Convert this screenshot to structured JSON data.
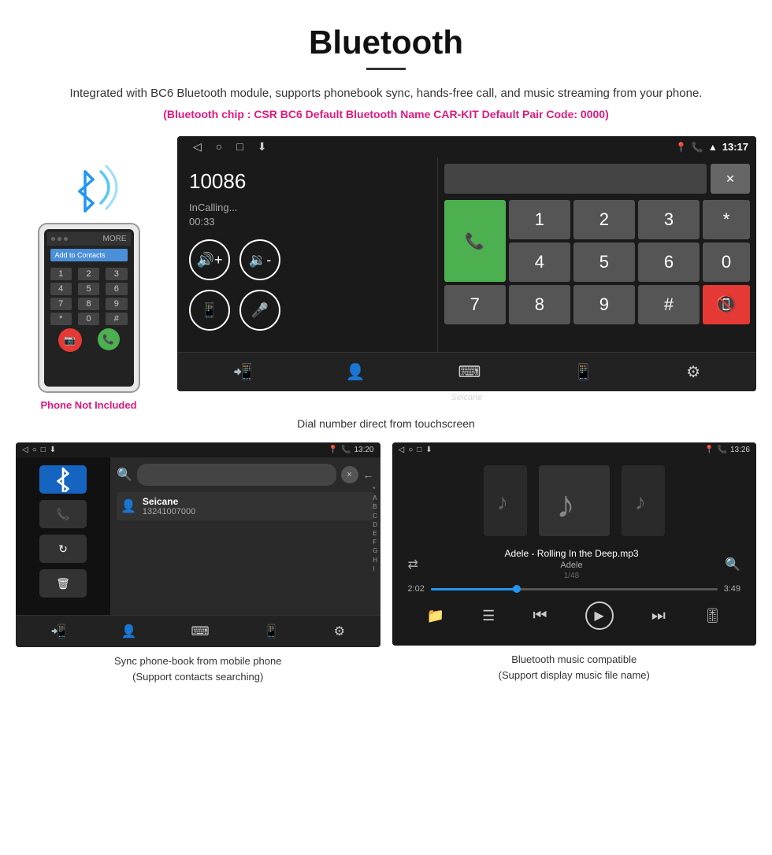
{
  "page": {
    "title": "Bluetooth",
    "divider": true,
    "description": "Integrated with BC6 Bluetooth module, supports phonebook sync, hands-free call, and music streaming from your phone.",
    "specs": "(Bluetooth chip : CSR BC6    Default Bluetooth Name CAR-KIT    Default Pair Code: 0000)"
  },
  "phone": {
    "not_included_label": "Phone Not Included",
    "add_contact": "Add to Contacts",
    "more_label": "MORE",
    "dialpad": {
      "rows": [
        [
          "1",
          "2",
          "3"
        ],
        [
          "4",
          "5",
          "6"
        ],
        [
          "7",
          "8",
          "9"
        ],
        [
          "*",
          "0",
          "#"
        ]
      ]
    }
  },
  "car_screen": {
    "status_time": "13:17",
    "number": "10086",
    "calling_status": "InCalling...",
    "timer": "00:33",
    "numpad": [
      "1",
      "2",
      "3",
      "*",
      "4",
      "5",
      "6",
      "0",
      "7",
      "8",
      "9",
      "#"
    ],
    "watermark": "Seicane"
  },
  "caption_main": "Dial number direct from touchscreen",
  "bottom_left": {
    "status_time": "13:20",
    "contact_name": "Seicane",
    "contact_number": "13241007000",
    "alphabet": [
      "*",
      "A",
      "B",
      "C",
      "D",
      "E",
      "F",
      "G",
      "H",
      "I"
    ],
    "caption_line1": "Sync phone-book from mobile phone",
    "caption_line2": "(Support contacts searching)"
  },
  "bottom_right": {
    "status_time": "13:26",
    "track_name": "Adele - Rolling In the Deep.mp3",
    "artist": "Adele",
    "track_count": "1/48",
    "time_current": "2:02",
    "time_total": "3:49",
    "progress_pct": 30,
    "caption_line1": "Bluetooth music compatible",
    "caption_line2": "(Support display music file name)"
  }
}
